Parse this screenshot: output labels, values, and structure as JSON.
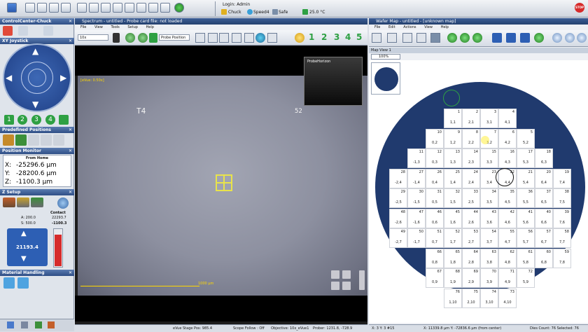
{
  "topbar": {
    "login": "Login: Admin",
    "chuck": "Chuck",
    "speed": "Speed4",
    "safe": "Safe",
    "temp": "25.0 °C",
    "stop": "STOP"
  },
  "left": {
    "control_center_title": "ControlCenter-Chuck",
    "xy_title": "XY Joystick",
    "speeds": [
      "1",
      "2",
      "3",
      "4"
    ],
    "predefined_title": "Predefined Positions",
    "position_title": "Position Monitor",
    "from_home": "From Home",
    "x_label": "X:",
    "x_value": "-25296.6 µm",
    "y_label": "Y:",
    "y_value": "-28200.6 µm",
    "z_label": "Z:",
    "z_value": "-1100.3 µm",
    "zsetup_title": "Z Setup",
    "a_val": "A: 200.0",
    "s_val": "S: 500.0",
    "contact_val": "22293.7",
    "contact_label": "Contact",
    "contact2": "-1100.3",
    "z_display": "21193.4",
    "material_title": "Material Handling"
  },
  "spectrum": {
    "title": "Spectrum - untitled - Probe card file: not loaded",
    "menu": [
      "File",
      "View",
      "Tools",
      "Setup",
      "Help"
    ],
    "zoom_select": "10x",
    "probe_select": "Probe Position",
    "numbers": [
      "1",
      "2",
      "3",
      "4",
      "5"
    ],
    "evue": "[eVue: 0.50x]",
    "label_t4": "T4",
    "label_52": "52",
    "scale": "1000 µm",
    "probe_horizon": "ProbeHorizon",
    "status": [
      "eVue Stage Pos: 985.4",
      "Scope Follow : Off",
      "Objective: 10x_eVue1",
      "Prober: 1231.8, -728.9"
    ]
  },
  "wafer": {
    "title": "Wafer Map - untitled - [unknown map]",
    "menu": [
      "File",
      "Edit",
      "Actions",
      "View",
      "Help"
    ],
    "map_view": "Map View 1",
    "zoom": "100%",
    "status_left": "X: 3 Y: 3 #15",
    "status_mid": "X: 11339.8 µm Y: -72836.6 µm (from center)",
    "status_right": "Dies Count: 76 Selected: 76",
    "dies": [
      {
        "n": "1",
        "c": "1,1",
        "col": 4,
        "row": 0
      },
      {
        "n": "2",
        "c": "2,1",
        "col": 5,
        "row": 0
      },
      {
        "n": "3",
        "c": "3,1",
        "col": 6,
        "row": 0
      },
      {
        "n": "4",
        "c": "4,1",
        "col": 7,
        "row": 0
      },
      {
        "n": "10",
        "c": "0,2",
        "col": 3,
        "row": 1
      },
      {
        "n": "9",
        "c": "1,2",
        "col": 4,
        "row": 1
      },
      {
        "n": "8",
        "c": "2,2",
        "col": 5,
        "row": 1
      },
      {
        "n": "7",
        "c": "3,2",
        "col": 6,
        "row": 1
      },
      {
        "n": "6",
        "c": "4,2",
        "col": 7,
        "row": 1
      },
      {
        "n": "5",
        "c": "5,2",
        "col": 8,
        "row": 1
      },
      {
        "n": "11",
        "c": "-1,3",
        "col": 2,
        "row": 2
      },
      {
        "n": "12",
        "c": "0,3",
        "col": 3,
        "row": 2
      },
      {
        "n": "13",
        "c": "1,3",
        "col": 4,
        "row": 2
      },
      {
        "n": "14",
        "c": "2,3",
        "col": 5,
        "row": 2
      },
      {
        "n": "15",
        "c": "3,3",
        "col": 6,
        "row": 2
      },
      {
        "n": "16",
        "c": "4,3",
        "col": 7,
        "row": 2
      },
      {
        "n": "17",
        "c": "5,3",
        "col": 8,
        "row": 2
      },
      {
        "n": "18",
        "c": "6,3",
        "col": 9,
        "row": 2
      },
      {
        "n": "28",
        "c": "-2,4",
        "col": 1,
        "row": 3
      },
      {
        "n": "27",
        "c": "-1,4",
        "col": 2,
        "row": 3
      },
      {
        "n": "26",
        "c": "0,4",
        "col": 3,
        "row": 3
      },
      {
        "n": "25",
        "c": "1,4",
        "col": 4,
        "row": 3
      },
      {
        "n": "24",
        "c": "2,4",
        "col": 5,
        "row": 3
      },
      {
        "n": "23",
        "c": "3,4",
        "col": 6,
        "row": 3
      },
      {
        "n": "22",
        "c": "4,4",
        "col": 7,
        "row": 3
      },
      {
        "n": "21",
        "c": "5,4",
        "col": 8,
        "row": 3
      },
      {
        "n": "20",
        "c": "6,4",
        "col": 9,
        "row": 3
      },
      {
        "n": "19",
        "c": "7,4",
        "col": 10,
        "row": 3
      },
      {
        "n": "29",
        "c": "-2,5",
        "col": 1,
        "row": 4
      },
      {
        "n": "30",
        "c": "-1,5",
        "col": 2,
        "row": 4
      },
      {
        "n": "31",
        "c": "0,5",
        "col": 3,
        "row": 4
      },
      {
        "n": "32",
        "c": "1,5",
        "col": 4,
        "row": 4
      },
      {
        "n": "33",
        "c": "2,5",
        "col": 5,
        "row": 4
      },
      {
        "n": "34",
        "c": "3,5",
        "col": 6,
        "row": 4
      },
      {
        "n": "35",
        "c": "4,5",
        "col": 7,
        "row": 4
      },
      {
        "n": "36",
        "c": "5,5",
        "col": 8,
        "row": 4
      },
      {
        "n": "37",
        "c": "6,5",
        "col": 9,
        "row": 4
      },
      {
        "n": "38",
        "c": "7,5",
        "col": 10,
        "row": 4
      },
      {
        "n": "48",
        "c": "-2,6",
        "col": 1,
        "row": 5
      },
      {
        "n": "47",
        "c": "-1,6",
        "col": 2,
        "row": 5
      },
      {
        "n": "46",
        "c": "0,6",
        "col": 3,
        "row": 5
      },
      {
        "n": "45",
        "c": "1,6",
        "col": 4,
        "row": 5
      },
      {
        "n": "44",
        "c": "2,6",
        "col": 5,
        "row": 5
      },
      {
        "n": "43",
        "c": "3,6",
        "col": 6,
        "row": 5
      },
      {
        "n": "42",
        "c": "4,6",
        "col": 7,
        "row": 5
      },
      {
        "n": "41",
        "c": "5,6",
        "col": 8,
        "row": 5
      },
      {
        "n": "40",
        "c": "6,6",
        "col": 9,
        "row": 5
      },
      {
        "n": "39",
        "c": "7,6",
        "col": 10,
        "row": 5
      },
      {
        "n": "49",
        "c": "-2,7",
        "col": 1,
        "row": 6
      },
      {
        "n": "50",
        "c": "-1,7",
        "col": 2,
        "row": 6
      },
      {
        "n": "51",
        "c": "0,7",
        "col": 3,
        "row": 6
      },
      {
        "n": "52",
        "c": "1,7",
        "col": 4,
        "row": 6
      },
      {
        "n": "53",
        "c": "2,7",
        "col": 5,
        "row": 6
      },
      {
        "n": "54",
        "c": "3,7",
        "col": 6,
        "row": 6
      },
      {
        "n": "55",
        "c": "4,7",
        "col": 7,
        "row": 6
      },
      {
        "n": "56",
        "c": "5,7",
        "col": 8,
        "row": 6
      },
      {
        "n": "57",
        "c": "6,7",
        "col": 9,
        "row": 6
      },
      {
        "n": "58",
        "c": "7,7",
        "col": 10,
        "row": 6
      },
      {
        "n": "66",
        "c": "0,8",
        "col": 3,
        "row": 7
      },
      {
        "n": "65",
        "c": "1,8",
        "col": 4,
        "row": 7
      },
      {
        "n": "64",
        "c": "2,8",
        "col": 5,
        "row": 7
      },
      {
        "n": "63",
        "c": "3,8",
        "col": 6,
        "row": 7
      },
      {
        "n": "62",
        "c": "4,8",
        "col": 7,
        "row": 7
      },
      {
        "n": "61",
        "c": "5,8",
        "col": 8,
        "row": 7
      },
      {
        "n": "60",
        "c": "6,8",
        "col": 9,
        "row": 7
      },
      {
        "n": "59",
        "c": "7,8",
        "col": 10,
        "row": 7
      },
      {
        "n": "67",
        "c": "0,9",
        "col": 3,
        "row": 8
      },
      {
        "n": "68",
        "c": "1,9",
        "col": 4,
        "row": 8
      },
      {
        "n": "69",
        "c": "2,9",
        "col": 5,
        "row": 8
      },
      {
        "n": "70",
        "c": "3,9",
        "col": 6,
        "row": 8
      },
      {
        "n": "71",
        "c": "4,9",
        "col": 7,
        "row": 8
      },
      {
        "n": "72",
        "c": "5,9",
        "col": 8,
        "row": 8
      },
      {
        "n": "76",
        "c": "1,10",
        "col": 4,
        "row": 9
      },
      {
        "n": "75",
        "c": "2,10",
        "col": 5,
        "row": 9
      },
      {
        "n": "74",
        "c": "3,10",
        "col": 6,
        "row": 9
      },
      {
        "n": "73",
        "c": "4,10",
        "col": 7,
        "row": 9
      }
    ]
  },
  "colors": {
    "wafer_blue": "#203a6e",
    "panel_header": "#2f4f86",
    "accent_green": "#2ea043",
    "accent_red": "#d62b2b"
  }
}
